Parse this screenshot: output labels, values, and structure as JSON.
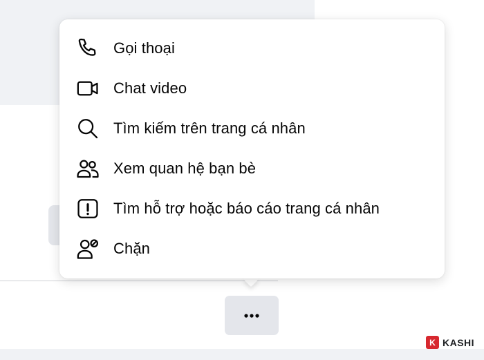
{
  "menu": {
    "items": [
      {
        "label": "Gọi thoại",
        "icon": "phone-icon"
      },
      {
        "label": "Chat video",
        "icon": "video-camera-icon"
      },
      {
        "label": "Tìm kiếm trên trang cá nhân",
        "icon": "search-icon"
      },
      {
        "label": "Xem quan hệ bạn bè",
        "icon": "friends-icon"
      },
      {
        "label": "Tìm hỗ trợ hoặc báo cáo trang cá nhân",
        "icon": "report-icon"
      },
      {
        "label": "Chặn",
        "icon": "block-user-icon"
      }
    ]
  },
  "more_button": {
    "icon": "more-dots-icon"
  },
  "watermark": {
    "logo_letter": "K",
    "text": "KASHI"
  },
  "colors": {
    "background_grey": "#f0f2f5",
    "button_grey": "#e4e6eb",
    "text": "#050505",
    "watermark_red": "#d7282f"
  }
}
